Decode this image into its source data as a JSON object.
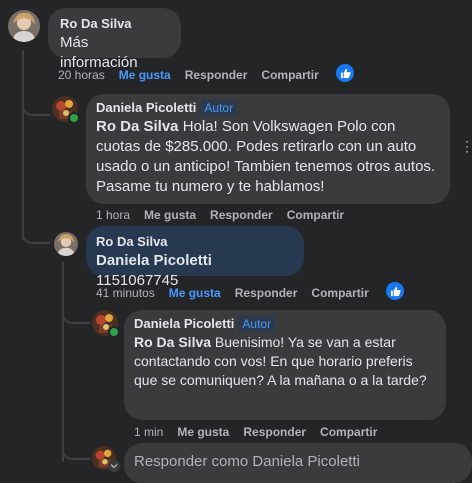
{
  "comments": [
    {
      "author": "Ro Da Silva",
      "text": "Más información",
      "meta": {
        "time": "20 horas",
        "like": "Me gusta",
        "reply": "Responder",
        "share": "Compartir"
      }
    },
    {
      "author": "Daniela Picoletti",
      "badge": "Autor",
      "mention": "Ro Da Silva",
      "text": " Hola! Son Volkswagen Polo con cuotas de $285.000. Podes retirarlo con un auto usado o un anticipo! Tambien tenemos otros autos. Pasame tu numero y te hablamos!",
      "meta": {
        "time": "1 hora",
        "like": "Me gusta",
        "reply": "Responder",
        "share": "Compartir"
      }
    },
    {
      "author": "Ro Da Silva",
      "mention": "Daniela Picoletti",
      "text": " 1151067745",
      "meta": {
        "time": "41 minutos",
        "like": "Me gusta",
        "reply": "Responder",
        "share": "Compartir"
      }
    },
    {
      "author": "Daniela Picoletti",
      "badge": "Autor",
      "mention": "Ro Da Silva",
      "text": " Buenisimo! Ya se van a estar contactando con vos! En que horario preferis que se comuniquen? A la mañana o a la tarde?",
      "meta": {
        "time": "1 min",
        "like": "Me gusta",
        "reply": "Responder",
        "share": "Compartir"
      }
    }
  ],
  "reply_box": {
    "placeholder": "Responder como Daniela Picoletti"
  },
  "icons": {
    "like": "thumbs-up-icon",
    "more": "more-options-icon",
    "chevron": "chevron-down-icon"
  },
  "colors": {
    "background": "#242526",
    "bubble": "#3a3b3c",
    "highlight_bubble": "#263951",
    "accent": "#4599ff",
    "online": "#31a24c"
  }
}
